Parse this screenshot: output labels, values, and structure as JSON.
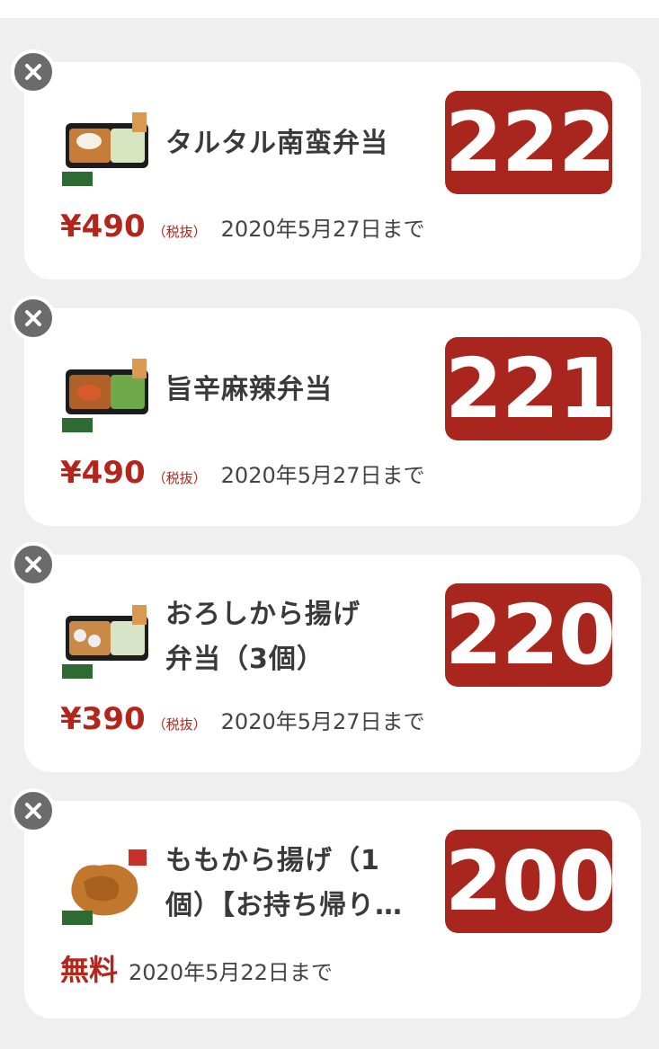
{
  "colors": {
    "accent": "#a8261d",
    "price": "#b4251c",
    "card_bg": "#ffffff",
    "page_bg": "#efefef"
  },
  "coupons": [
    {
      "title": "タルタル南蛮弁当",
      "code": "222",
      "price": "¥490",
      "tax_note": "（税抜）",
      "expiry": "2020年5月27日まで",
      "thumb_icon": "bento-box-icon"
    },
    {
      "title": "旨辛麻辣弁当",
      "code": "221",
      "price": "¥490",
      "tax_note": "（税抜）",
      "expiry": "2020年5月27日まで",
      "thumb_icon": "bento-box-icon"
    },
    {
      "title": "おろしから揚げ\n弁当（3個）",
      "code": "220",
      "price": "¥390",
      "tax_note": "（税抜）",
      "expiry": "2020年5月27日まで",
      "thumb_icon": "bento-box-icon"
    },
    {
      "title": "ももから揚げ（1\n個）【お持ち帰り…",
      "code": "200",
      "price_free": "無料",
      "expiry": "2020年5月22日まで",
      "thumb_icon": "fried-chicken-icon"
    }
  ]
}
